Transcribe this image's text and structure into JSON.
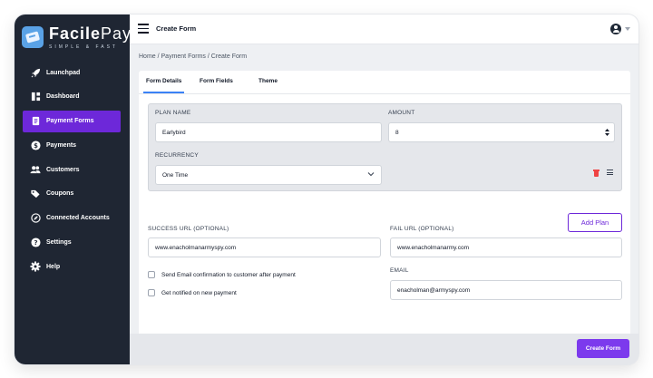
{
  "brand": {
    "name_bold": "Facile",
    "name_light": "Pay",
    "tagline": "SIMPLE & FAST"
  },
  "sidebar": {
    "items": [
      {
        "label": "Launchpad",
        "icon": "rocket-icon",
        "active": false
      },
      {
        "label": "Dashboard",
        "icon": "dashboard-icon",
        "active": false
      },
      {
        "label": "Payment Forms",
        "icon": "form-icon",
        "active": true
      },
      {
        "label": "Payments",
        "icon": "dollar-icon",
        "active": false
      },
      {
        "label": "Customers",
        "icon": "users-icon",
        "active": false
      },
      {
        "label": "Coupons",
        "icon": "tag-icon",
        "active": false
      },
      {
        "label": "Connected Accounts",
        "icon": "link-icon",
        "active": false
      },
      {
        "label": "Settings",
        "icon": "help-circle-icon",
        "active": false
      },
      {
        "label": "Help",
        "icon": "gear-icon",
        "active": false
      }
    ]
  },
  "header": {
    "title": "Create Form"
  },
  "breadcrumb": "Home / Payment Forms / Create Form",
  "tabs": [
    {
      "label": "Form Details",
      "active": true
    },
    {
      "label": "Form Fields",
      "active": false
    },
    {
      "label": "Theme",
      "active": false
    }
  ],
  "plan": {
    "plan_name_label": "PLAN NAME",
    "plan_name_value": "Earlybird",
    "amount_label": "AMOUNT",
    "amount_value": "8",
    "recurrency_label": "RECURRENCY",
    "recurrency_value": "One Time"
  },
  "add_plan_label": "Add Plan",
  "success_url": {
    "label": "SUCCESS URL (OPTIONAL)",
    "value": "www.enacholmanarmyspy.com"
  },
  "fail_url": {
    "label": "FAIL URL (OPTIONAL)",
    "value": "www.enacholmanarmy.com"
  },
  "email": {
    "label": "EMAIL",
    "value": "enacholman@armyspy.com"
  },
  "checkboxes": [
    {
      "label": "Send Email confirmation to customer after payment",
      "checked": false
    },
    {
      "label": "Get notified on new payment",
      "checked": false
    }
  ],
  "footer": {
    "create_label": "Create Form"
  },
  "colors": {
    "sidebar": "#1f2633",
    "accent": "#6d28d9",
    "button": "#7c3aed",
    "tab_underline": "#3b82f6"
  }
}
